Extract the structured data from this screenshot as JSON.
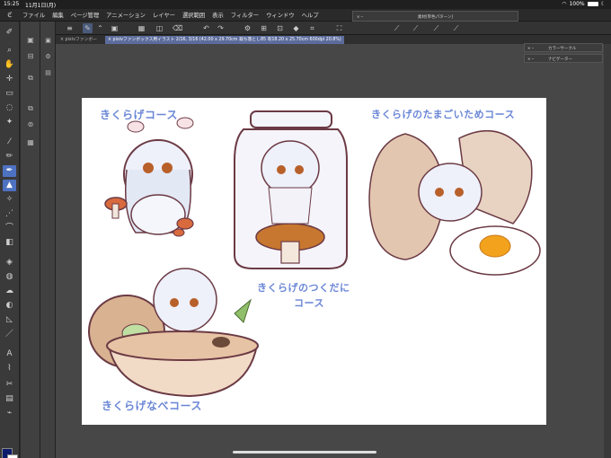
{
  "status": {
    "time": "15:25",
    "date": "11月1日(月)",
    "battery": "100%"
  },
  "menu": [
    "ファイル",
    "編集",
    "ページ管理",
    "アニメーション",
    "レイヤー",
    "選択範囲",
    "表示",
    "フィルター",
    "ウィンドウ",
    "ヘルプ"
  ],
  "subwindow": {
    "title": "素材[単色パターン]"
  },
  "tabs": [
    {
      "label": "× pixivファンボー"
    },
    {
      "label": "× pixivファンボックス用イラスト 2/16, 3/16 (42.00 x 29.70cm 裁ち落とし85 有18.20 x 25.70cm 600dpi 20.8%)"
    }
  ],
  "right_panels": {
    "color_circle": "カラーサークル",
    "navigator": "ナビゲーター"
  },
  "artwork": {
    "label_1": "きくらげコース",
    "label_2": "きくらげのたまごいためコース",
    "label_3a": "きくらげのつくだに",
    "label_3b": "コース",
    "label_4": "きくらげなべコース"
  },
  "colors": {
    "main": "#0d1a6b",
    "sub": "#ffffff",
    "accent": "#4e72c2"
  }
}
